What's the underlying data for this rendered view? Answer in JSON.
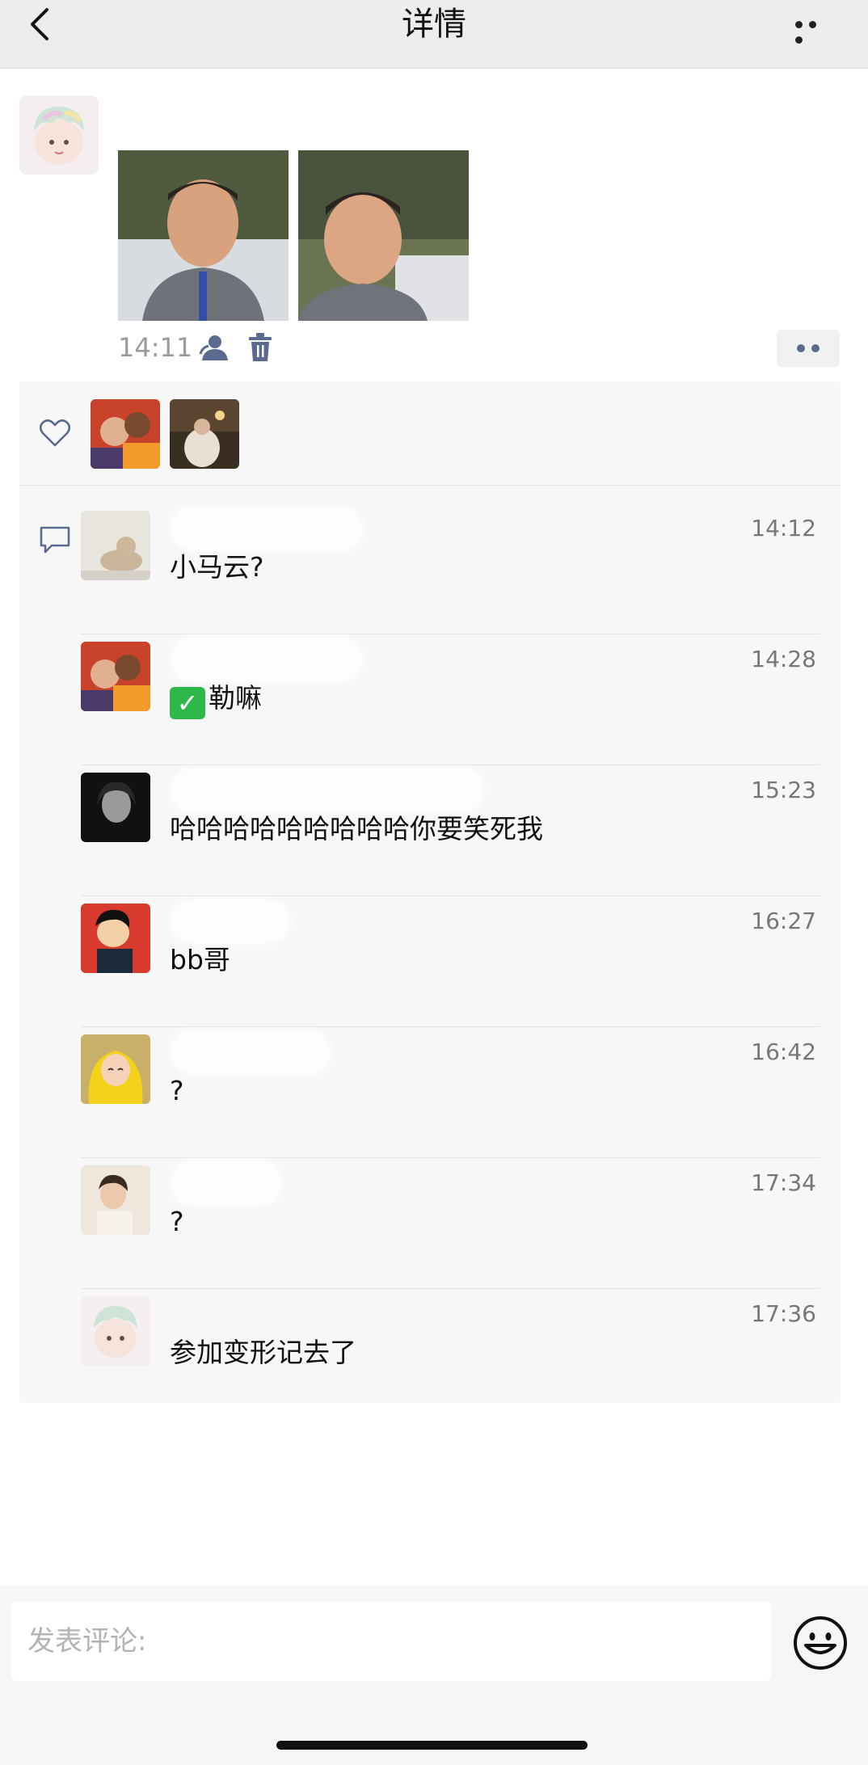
{
  "header": {
    "title": "详情",
    "back_icon": "chevron-left-icon",
    "more_icon": "more-dots-icon"
  },
  "post": {
    "time": "14:11",
    "visibility_icon": "person-icon",
    "delete_icon": "trash-icon",
    "action_icon": "more-dots-icon"
  },
  "likes": {
    "icon": "heart-icon"
  },
  "comments_icon": "comment-bubble-icon",
  "comments": [
    {
      "time": "14:12",
      "text": "小马云?"
    },
    {
      "time": "14:28",
      "text": "勒嘛",
      "emoji": "✓"
    },
    {
      "time": "15:23",
      "text": "哈哈哈哈哈哈哈哈哈你要笑死我"
    },
    {
      "time": "16:27",
      "text": "bb哥"
    },
    {
      "time": "16:42",
      "text": "?"
    },
    {
      "time": "17:34",
      "text": "?"
    },
    {
      "time": "17:36",
      "text": "参加变形记去了"
    }
  ],
  "input": {
    "placeholder": "发表评论:",
    "emoji_icon": "smiley-icon"
  },
  "colors": {
    "header_bg": "#ededed",
    "panel_bg": "#f7f7f7",
    "accent_link": "#5b6b8f",
    "time_gray": "#9b9b9b"
  }
}
